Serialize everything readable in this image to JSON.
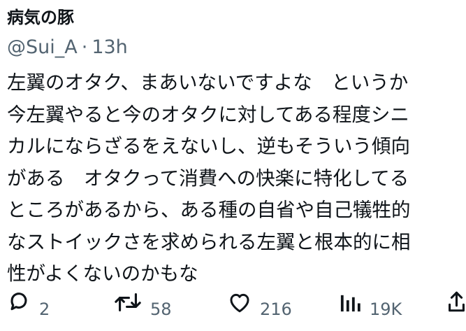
{
  "tweet": {
    "display_name": "病気の豚",
    "handle": "@Sui_A",
    "separator": "·",
    "time": "13h",
    "lines": [
      "左翼のオタク、まあいないですよな　というか",
      "今左翼やると今のオタクに対してある程度シニ",
      "カルにならざるをえないし、逆もそういう傾向",
      "がある　オタクって消費への快楽に特化してる",
      "ところがあるから、ある種の自省や自己犠牲的",
      "なストイックさを求められる左翼と根本的に相",
      "性がよくないのかもな"
    ]
  },
  "actions": {
    "reply": {
      "icon": "reply-icon",
      "count": "2"
    },
    "retweet": {
      "icon": "retweet-icon",
      "count": "58"
    },
    "like": {
      "icon": "heart-icon",
      "count": "216"
    },
    "views": {
      "icon": "views-icon",
      "count": "19K"
    },
    "share": {
      "icon": "share-icon"
    }
  },
  "colors": {
    "text": "#0f1419",
    "muted": "#536471",
    "background": "#ffffff"
  }
}
